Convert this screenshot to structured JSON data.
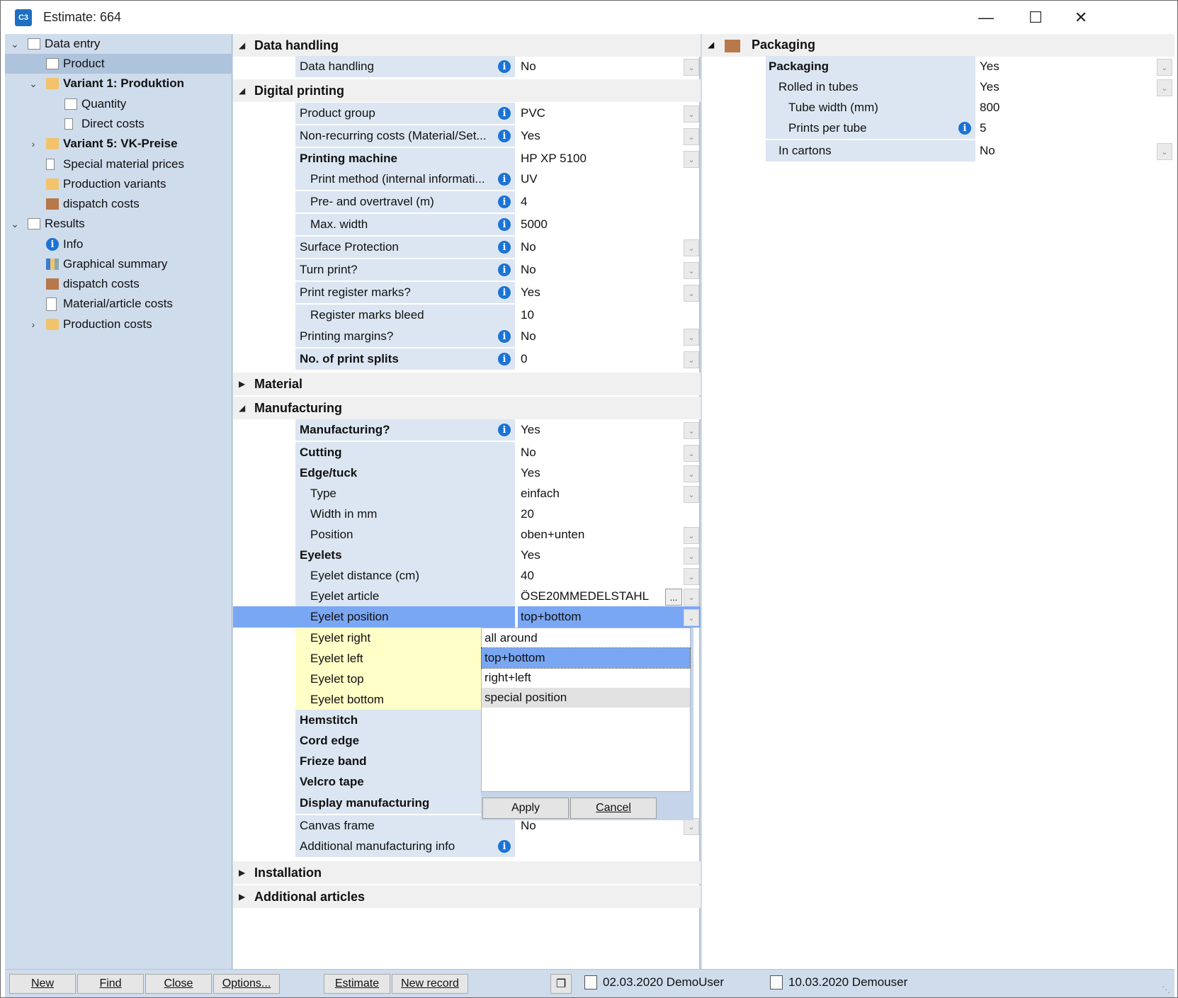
{
  "window": {
    "title": "Estimate: 664",
    "app_icon_text": "C3"
  },
  "tree": {
    "items": [
      {
        "label": "Data entry"
      },
      {
        "label": "Product"
      },
      {
        "label": "Variant 1: Produktion"
      },
      {
        "label": "Quantity"
      },
      {
        "label": "Direct costs"
      },
      {
        "label": "Variant 5: VK-Preise"
      },
      {
        "label": "Special material prices"
      },
      {
        "label": "Production variants"
      },
      {
        "label": "dispatch costs"
      },
      {
        "label": "Results"
      },
      {
        "label": "Info"
      },
      {
        "label": "Graphical summary"
      },
      {
        "label": "dispatch costs"
      },
      {
        "label": "Material/article costs"
      },
      {
        "label": "Production costs"
      }
    ]
  },
  "sections": {
    "data_handling": "Data handling",
    "digital_printing": "Digital printing",
    "material": "Material",
    "manufacturing": "Manufacturing",
    "installation": "Installation",
    "additional_articles": "Additional articles",
    "packaging": "Packaging"
  },
  "data_handling_rows": [
    {
      "label": "Data handling",
      "value": "No"
    }
  ],
  "digital_printing_rows": [
    {
      "label": "Product group",
      "value": "PVC"
    },
    {
      "label": "Non-recurring costs (Material/Set...",
      "value": "Yes"
    },
    {
      "label": "Printing machine",
      "value": "HP XP 5100"
    },
    {
      "label": "Print method (internal informati...",
      "value": "UV"
    },
    {
      "label": "Pre- and overtravel (m)",
      "value": "4"
    },
    {
      "label": "Max. width",
      "value": "5000"
    },
    {
      "label": "Surface Protection",
      "value": "No"
    },
    {
      "label": "Turn print?",
      "value": "No"
    },
    {
      "label": "Print register marks?",
      "value": "Yes"
    },
    {
      "label": "Register marks bleed",
      "value": "10"
    },
    {
      "label": "Printing margins?",
      "value": "No"
    },
    {
      "label": "No. of print splits",
      "value": "0"
    }
  ],
  "manufacturing_rows": [
    {
      "label": "Manufacturing?",
      "value": "Yes"
    },
    {
      "label": "Cutting",
      "value": "No"
    },
    {
      "label": "Edge/tuck",
      "value": "Yes"
    },
    {
      "label": "Type",
      "value": "einfach"
    },
    {
      "label": "Width in mm",
      "value": "20"
    },
    {
      "label": "Position",
      "value": "oben+unten"
    },
    {
      "label": "Eyelets",
      "value": "Yes"
    },
    {
      "label": "Eyelet distance (cm)",
      "value": "40"
    },
    {
      "label": "Eyelet article",
      "value": "ÖSE20MMEDELSTAHL"
    },
    {
      "label": "Eyelet position",
      "value": "top+bottom"
    },
    {
      "label": "Eyelet right",
      "value": ""
    },
    {
      "label": "Eyelet left",
      "value": ""
    },
    {
      "label": "Eyelet top",
      "value": ""
    },
    {
      "label": "Eyelet bottom",
      "value": ""
    },
    {
      "label": "Hemstitch",
      "value": ""
    },
    {
      "label": "Cord edge",
      "value": ""
    },
    {
      "label": "Frieze band",
      "value": ""
    },
    {
      "label": "Velcro tape",
      "value": ""
    },
    {
      "label": "Display manufacturing",
      "value": ""
    },
    {
      "label": "Canvas frame",
      "value": "No"
    },
    {
      "label": "Additional manufacturing info",
      "value": ""
    }
  ],
  "ellipsis": "...",
  "popup": {
    "options": [
      "all around",
      "top+bottom",
      "right+left",
      "special position"
    ],
    "selected": "top+bottom",
    "apply": "Apply",
    "cancel": "Cancel"
  },
  "packaging_rows": [
    {
      "label": "Packaging",
      "value": "Yes"
    },
    {
      "label": "Rolled in tubes",
      "value": "Yes"
    },
    {
      "label": "Tube width (mm)",
      "value": "800"
    },
    {
      "label": "Prints per tube",
      "value": "5"
    },
    {
      "label": "In cartons",
      "value": "No"
    }
  ],
  "toolbar": {
    "new": "New",
    "find": "Find",
    "close": "Close",
    "options": "Options...",
    "estimate": "Estimate",
    "new_record": "New record"
  },
  "status": {
    "created": "02.03.2020 DemoUser",
    "saved": "10.03.2020 Demouser"
  },
  "colors": {
    "accent_selection": "#7aa7f3",
    "label_background": "#dce6f2",
    "info_blue": "#1b73d6",
    "panel_background": "#cfdcec",
    "highlight_yellow": "#ffffc8"
  }
}
